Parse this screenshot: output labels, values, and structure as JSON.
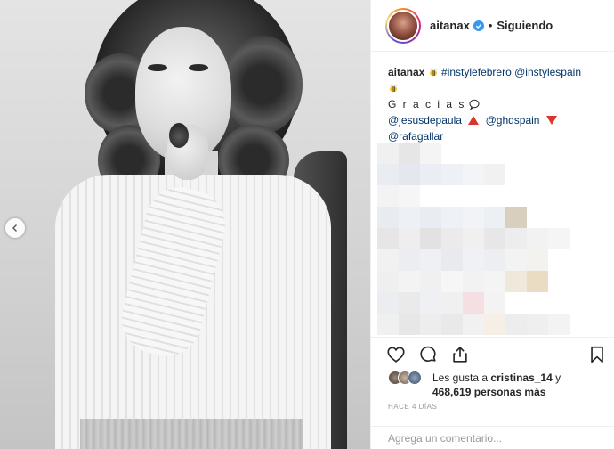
{
  "header": {
    "username": "aitanax",
    "separator": "•",
    "follow_state": "Siguiendo"
  },
  "caption": {
    "username": "aitanax",
    "hashtag": "#instylefebrero",
    "mention1": "@instylespain",
    "thanks": "G r a c i a s",
    "mention2": "@jesusdepaula",
    "mention3": "@ghdspain",
    "mention4": "@rafagallar"
  },
  "likes": {
    "prefix": "Les gusta a ",
    "first_liker": "cristinas_14",
    "connector": " y",
    "count": "468,619",
    "suffix": "personas más"
  },
  "time": "HACE 4 DÍAS",
  "comment": {
    "placeholder": "Agrega un comentario..."
  },
  "icons": {
    "prev": "chevron-left-icon",
    "like": "heart-icon",
    "comment": "comment-icon",
    "share": "share-icon",
    "save": "bookmark-icon",
    "verified": "verified-badge-icon"
  },
  "colors": {
    "link": "#003569",
    "verified": "#3897f0",
    "muted": "#999999"
  }
}
